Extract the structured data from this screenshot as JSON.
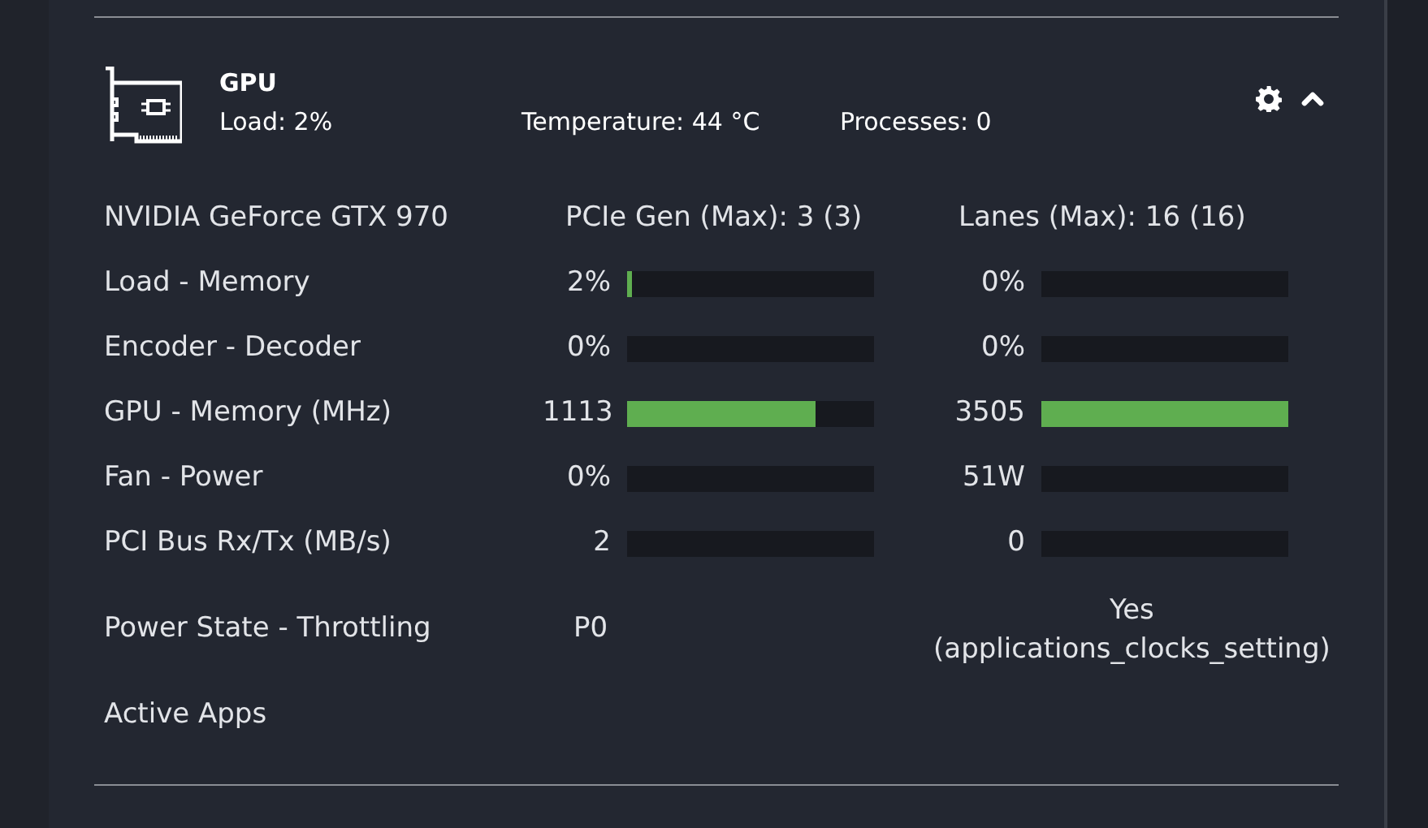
{
  "card": {
    "title": "GPU",
    "summary": [
      "Load: 2%",
      "Temperature: 44 °C",
      "Processes: 0"
    ],
    "expanded": true
  },
  "rows": [
    {
      "kind": "info",
      "label": "NVIDIA GeForce GTX 970",
      "text_1": "PCIe Gen (Max): 3 (3)",
      "text_2": "Lanes (Max): 16 (16)"
    },
    {
      "kind": "bars",
      "label": "Load - Memory",
      "meters": [
        {
          "value": "2%",
          "level": 0.02
        },
        {
          "value": "0%",
          "level": 0
        }
      ]
    },
    {
      "kind": "bars",
      "label": "Encoder - Decoder",
      "meters": [
        {
          "value": "0%",
          "level": 0
        },
        {
          "value": "0%",
          "level": 0
        }
      ]
    },
    {
      "kind": "bars",
      "label": "GPU - Memory (MHz)",
      "meters": [
        {
          "value": "1113",
          "level": 0.76
        },
        {
          "value": "3505",
          "level": 1
        }
      ]
    },
    {
      "kind": "bars",
      "label": "Fan - Power",
      "meters": [
        {
          "value": "0%",
          "level": 0
        },
        {
          "value": "51W",
          "level": 0
        }
      ]
    },
    {
      "kind": "bars",
      "label": "PCI Bus Rx/Tx (MB/s)",
      "meters": [
        {
          "value": "2",
          "level": 0
        },
        {
          "value": "0",
          "level": 0
        }
      ]
    },
    {
      "kind": "state",
      "label": "Power State - Throttling",
      "text_1": "P0",
      "text_2": "Yes (applications_clocks_setting)"
    },
    {
      "kind": "label",
      "label": "Active Apps"
    }
  ]
}
